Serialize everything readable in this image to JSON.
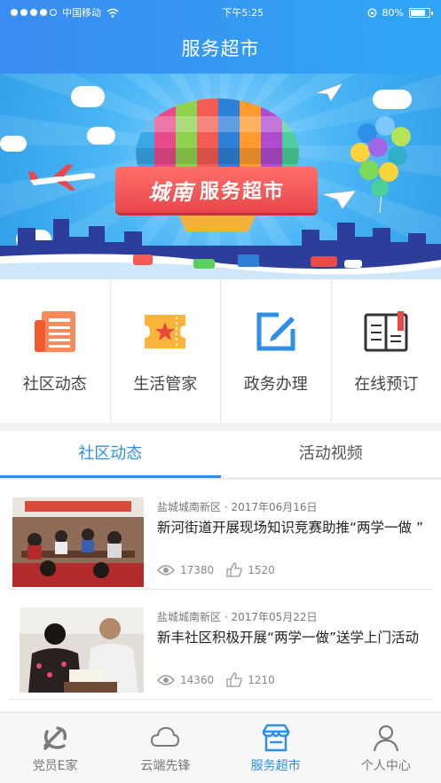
{
  "status_bar": {
    "carrier": "中国移动",
    "time": "下午5:25",
    "battery": "80%",
    "battery_level": 0.8
  },
  "nav": {
    "title": "服务超市"
  },
  "banner": {
    "accent_text": "城南",
    "title_text": "服务超市"
  },
  "quick_links": [
    {
      "label": "社区动态",
      "icon": "news-icon"
    },
    {
      "label": "生活管家",
      "icon": "ticket-icon"
    },
    {
      "label": "政务办理",
      "icon": "edit-icon"
    },
    {
      "label": "在线预订",
      "icon": "book-icon"
    }
  ],
  "tabs": [
    {
      "label": "社区动态",
      "active": true
    },
    {
      "label": "活动视频",
      "active": false
    }
  ],
  "news": [
    {
      "source": "盐城城南新区",
      "date": "2017年06月16日",
      "title": "新河街道开展现场知识竞赛助推“两学一做 ”",
      "views": "17380",
      "likes": "1520"
    },
    {
      "source": "盐城城南新区",
      "date": "2017年05月22日",
      "title": "新丰社区积极开展“两学一做”送学上门活动",
      "views": "14360",
      "likes": "1210"
    }
  ],
  "tabbar": [
    {
      "label": "党员E家",
      "icon": "party-emblem-icon",
      "active": false
    },
    {
      "label": "云端先锋",
      "icon": "cloud-icon",
      "active": false
    },
    {
      "label": "服务超市",
      "icon": "store-icon",
      "active": true
    },
    {
      "label": "个人中心",
      "icon": "user-icon",
      "active": false
    }
  ],
  "colors": {
    "primary": "#2f8fe8",
    "accent_red": "#e9474c",
    "icon_orange": "#f07c3a"
  }
}
